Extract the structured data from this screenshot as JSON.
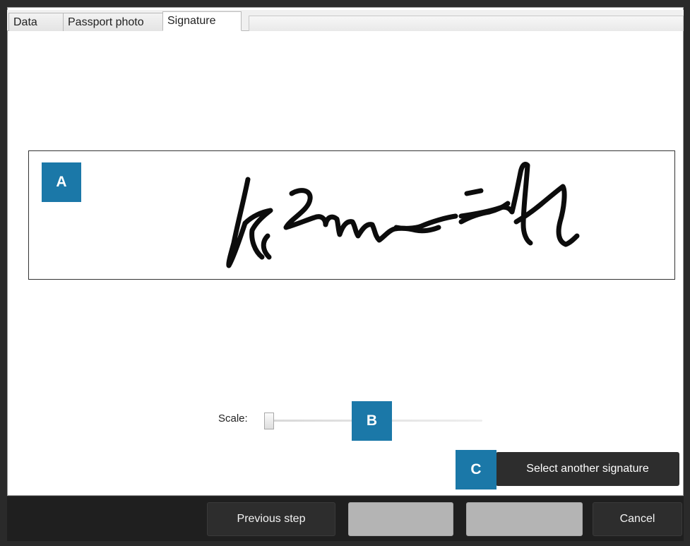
{
  "tabs": [
    {
      "label": "Data",
      "active": false
    },
    {
      "label": "Passport photo",
      "active": false
    },
    {
      "label": "Signature",
      "active": true
    }
  ],
  "callouts": {
    "a": "A",
    "b": "B",
    "c": "C"
  },
  "scale": {
    "label": "Scale:",
    "value": 0.0
  },
  "select_signature_button": "Select another signature",
  "footer": {
    "previous_label": "Previous step",
    "next_label": "",
    "finish_label": "",
    "cancel_label": "Cancel"
  },
  "colors": {
    "callout": "#1b78a8",
    "dark_button": "#2d2d2d",
    "disabled_button": "#b4b4b4"
  }
}
